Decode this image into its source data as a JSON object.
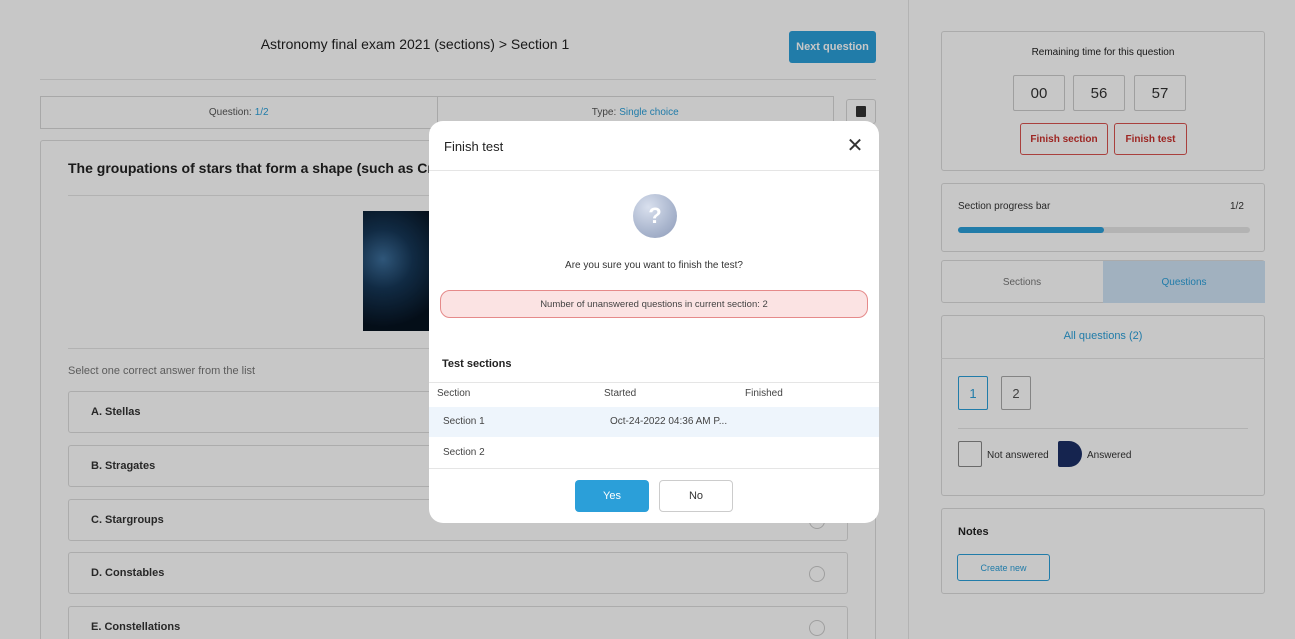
{
  "header": {
    "exam_title": "Astronomy final exam 2021 (sections) > Section 1",
    "next_question_label": "Next question"
  },
  "question_info": {
    "question_label": "Question:",
    "question_value": "1/2",
    "type_label": "Type:",
    "type_value": "Single choice"
  },
  "question": {
    "text": "The groupations of stars that form a shape (such as Crux a",
    "hint": "Select one correct answer from the list",
    "options": [
      {
        "label": "A.  Stellas"
      },
      {
        "label": "B.  Stragates"
      },
      {
        "label": "C.  Stargroups"
      },
      {
        "label": "D.  Constables"
      },
      {
        "label": "E.  Constellations"
      }
    ]
  },
  "sidebar": {
    "remaining_time_title": "Remaining time for this question",
    "time": {
      "h": "00",
      "m": "56",
      "s": "57"
    },
    "finish_section_label": "Finish section",
    "finish_test_label": "Finish test",
    "progress_label": "Section progress bar",
    "progress_count": "1/2",
    "progress_value": 0.5,
    "tabs": {
      "sections": "Sections",
      "questions": "Questions"
    },
    "all_questions_label": "All questions (2)",
    "question_numbers": [
      "1",
      "2"
    ],
    "legend": {
      "not_answered": "Not answered",
      "answered": "Answered"
    },
    "notes_title": "Notes",
    "create_new_label": "Create new"
  },
  "modal": {
    "title": "Finish test",
    "close_glyph": "✕",
    "question_glyph": "?",
    "question": "Are you sure you want to finish the test?",
    "alert": "Number of unanswered questions in current section: 2",
    "sections_title": "Test sections",
    "columns": {
      "section": "Section",
      "started": "Started",
      "finished": "Finished"
    },
    "rows": [
      {
        "section": "Section 1",
        "started": "Oct-24-2022 04:36 AM P...",
        "finished": ""
      },
      {
        "section": "Section 2",
        "started": "",
        "finished": ""
      }
    ],
    "yes_label": "Yes",
    "no_label": "No"
  },
  "colors": {
    "accent": "#2b9fd9",
    "danger": "#d9534f",
    "alert_bg": "#fbe3e3",
    "answered_legend": "#1b2f66"
  }
}
